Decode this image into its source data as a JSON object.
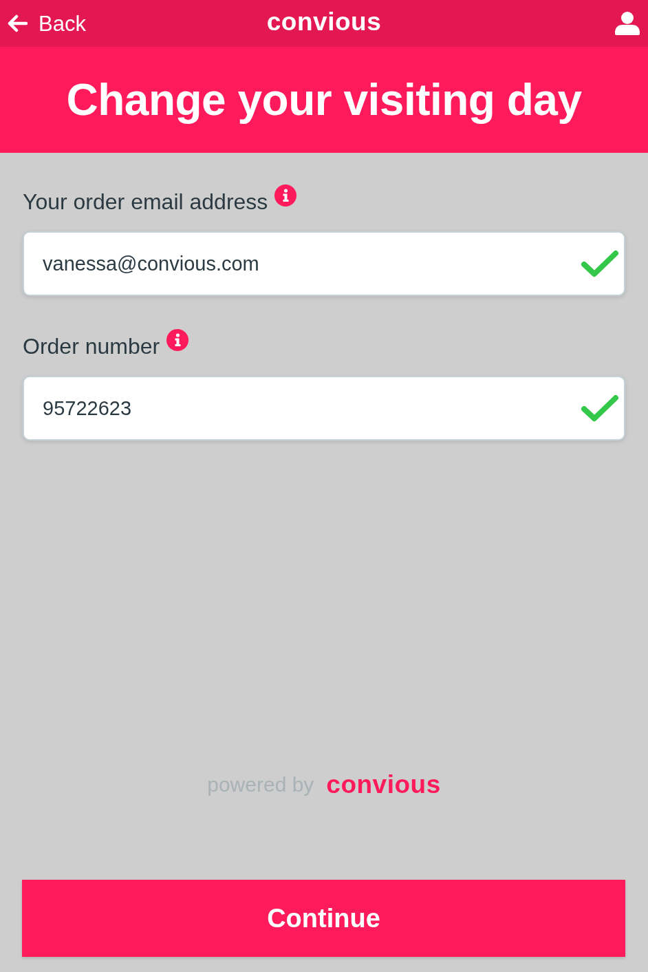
{
  "header": {
    "back_label": "Back",
    "logo": "convious"
  },
  "title": "Change your visiting day",
  "fields": [
    {
      "label": "Your order email address",
      "value": "vanessa@convious.com",
      "valid": true
    },
    {
      "label": "Order number",
      "value": "95722623",
      "valid": true
    }
  ],
  "footer": {
    "powered_by": "powered by",
    "logo": "convious"
  },
  "button": "Continue"
}
